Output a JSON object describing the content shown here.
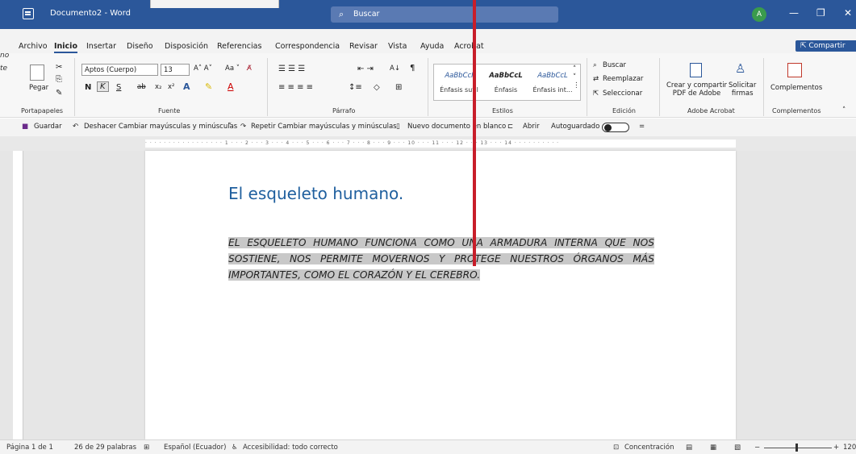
{
  "titlebar": {
    "doc_title": "Documento2 - Word",
    "search_placeholder": "Buscar",
    "avatar_initial": "A",
    "minimize": "—",
    "restore": "❐",
    "close": "✕"
  },
  "tabs": [
    "Archivo",
    "Inicio",
    "Insertar",
    "Diseño",
    "Disposición",
    "Referencias",
    "Correspondencia",
    "Revisar",
    "Vista",
    "Ayuda",
    "Acrobat"
  ],
  "share_label": "Compartir",
  "ribbon": {
    "clipboard": {
      "paste_label": "Pegar",
      "group_label": "Portapapeles"
    },
    "font": {
      "font_name": "Aptos (Cuerpo)",
      "font_size": "13",
      "group_label": "Fuente"
    },
    "paragraph": {
      "group_label": "Párrafo"
    },
    "styles": {
      "items": [
        {
          "sample": "AaBbCcI",
          "name": "Énfasis sutil"
        },
        {
          "sample": "AaBbCcL",
          "name": "Énfasis"
        },
        {
          "sample": "AaBbCcL",
          "name": "Énfasis int..."
        }
      ],
      "group_label": "Estilos"
    },
    "editing": {
      "find": "Buscar",
      "replace": "Reemplazar",
      "select": "Seleccionar",
      "group_label": "Edición"
    },
    "acrobat": {
      "create_pdf": "Crear y compartir\nPDF de Adobe",
      "request_sign": "Solicitar\nfirmas",
      "group_label": "Adobe Acrobat"
    },
    "addins": {
      "label": "Complementos",
      "group_label": "Complementos"
    }
  },
  "qat": {
    "save": "Guardar",
    "undo": "Deshacer Cambiar mayúsculas y minúsculas",
    "redo": "Repetir Cambiar mayúsculas y minúsculas",
    "new_doc": "Nuevo documento en blanco",
    "open": "Abrir",
    "autosave": "Autoguardado"
  },
  "document": {
    "heading": "El esqueleto humano.",
    "paragraph": "EL ESQUELETO HUMANO FUNCIONA COMO UNA ARMADURA INTERNA QUE NOS SOSTIENE, NOS PERMITE MOVERNOS Y PROTEGE NUESTROS ÓRGANOS MÁS IMPORTANTES, COMO EL CORAZÓN Y EL CEREBRO."
  },
  "left_fragments": [
    "no",
    "te"
  ],
  "status": {
    "page": "Página 1 de 1",
    "words": "26 de 29 palabras",
    "language": "Español (Ecuador)",
    "accessibility": "Accesibilidad: todo correcto",
    "focus": "Concentración",
    "zoom": "120"
  },
  "colors": {
    "titlebar": "#2b579a",
    "accent": "#2b579a",
    "heading": "#1f5f9e",
    "selection": "#c8c8c8",
    "red_line": "#c81e2a"
  }
}
